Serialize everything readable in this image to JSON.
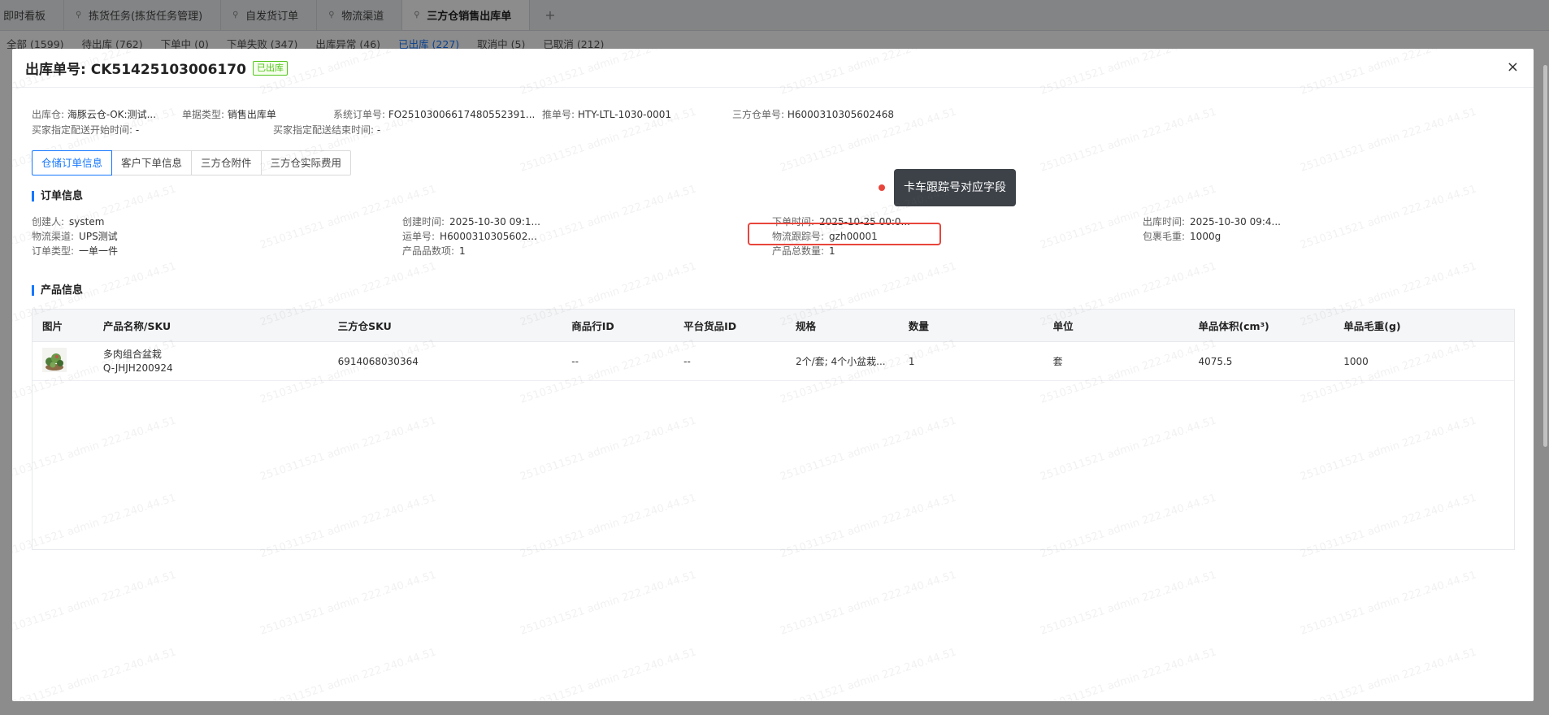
{
  "top_tabs": [
    {
      "label": "即时看板",
      "pinned": false,
      "active": false
    },
    {
      "label": "拣货任务(拣货任务管理)",
      "pinned": true,
      "active": false
    },
    {
      "label": "自发货订单",
      "pinned": true,
      "active": false
    },
    {
      "label": "物流渠道",
      "pinned": true,
      "active": false
    },
    {
      "label": "三方仓销售出库单",
      "pinned": true,
      "active": true
    }
  ],
  "add_tab": "+",
  "status_filters": [
    {
      "label": "全部 (1599)",
      "active": false
    },
    {
      "label": "待出库 (762)",
      "active": false
    },
    {
      "label": "下单中 (0)",
      "active": false
    },
    {
      "label": "下单失败 (347)",
      "active": false
    },
    {
      "label": "出库异常 (46)",
      "active": false
    },
    {
      "label": "已出库 (227)",
      "active": true
    },
    {
      "label": "取消中 (5)",
      "active": false
    },
    {
      "label": "已取消 (212)",
      "active": false
    }
  ],
  "modal": {
    "title": "出库单号: CK51425103006170",
    "status_tag": "已出库",
    "close": "×",
    "meta_row1": [
      {
        "label": "出库仓:",
        "value": "海豚云仓-OK:测试..."
      },
      {
        "label": "单据类型:",
        "value": "销售出库单"
      },
      {
        "label": "系统订单号:",
        "value": "FO25103006617480552391..."
      },
      {
        "label": "推单号:",
        "value": "HTY-LTL-1030-0001"
      },
      {
        "label": "三方仓单号:",
        "value": "H6000310305602468"
      }
    ],
    "meta_row2": [
      {
        "label": "买家指定配送开始时间:",
        "value": "-"
      },
      {
        "label": "买家指定配送结束时间:",
        "value": "-"
      }
    ],
    "inner_tabs": [
      {
        "label": "仓储订单信息",
        "active": true
      },
      {
        "label": "客户下单信息",
        "active": false
      },
      {
        "label": "三方仓附件",
        "active": false
      },
      {
        "label": "三方仓实际费用",
        "active": false
      }
    ],
    "order_section_title": "订单信息",
    "order_fields": {
      "creator": {
        "label": "创建人:",
        "value": "system"
      },
      "created_at": {
        "label": "创建时间:",
        "value": "2025-10-30 09:1..."
      },
      "ordered_at": {
        "label": "下单时间:",
        "value": "2025-10-25 00:0..."
      },
      "shipped_at": {
        "label": "出库时间:",
        "value": "2025-10-30 09:4..."
      },
      "channel": {
        "label": "物流渠道:",
        "value": "UPS测试"
      },
      "waybill": {
        "label": "运单号:",
        "value": "H6000310305602..."
      },
      "tracking": {
        "label": "物流跟踪号:",
        "value": "gzh00001"
      },
      "gross_weight": {
        "label": "包裹毛重:",
        "value": "1000g"
      },
      "order_type": {
        "label": "订单类型:",
        "value": "一单一件"
      },
      "sku_count": {
        "label": "产品品数项:",
        "value": "1"
      },
      "total_qty": {
        "label": "产品总数量:",
        "value": "1"
      }
    },
    "tooltip": "卡车跟踪号对应字段",
    "product_section_title": "产品信息",
    "table": {
      "headers": [
        "图片",
        "产品名称/SKU",
        "三方仓SKU",
        "商品行ID",
        "平台货品ID",
        "规格",
        "数量",
        "单位",
        "单品体积(cm³)",
        "单品毛重(g)"
      ],
      "rows": [
        {
          "name": "多肉组合盆栽",
          "sku": "Q-JHJH200924",
          "third_sku": "6914068030364",
          "line_id": "--",
          "platform_id": "--",
          "spec": "2个/套; 4个小盆栽...",
          "qty": "1",
          "unit": "套",
          "volume": "4075.5",
          "weight": "1000"
        }
      ]
    }
  },
  "watermark_text": "2510311521 admin 222.240.44.51"
}
